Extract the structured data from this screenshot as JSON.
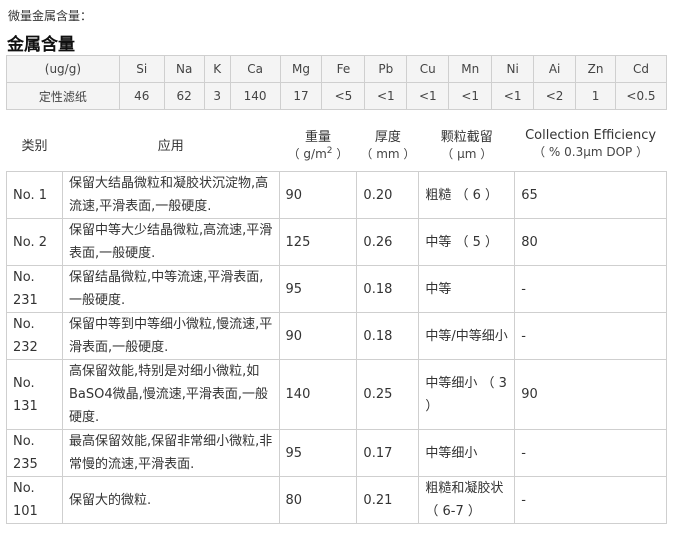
{
  "small_title": "微量金属含量：",
  "big_title": "金属含量",
  "metals": {
    "header": [
      "(ug/g)",
      "Si",
      "Na",
      "K",
      "Ca",
      "Mg",
      "Fe",
      "Pb",
      "Cu",
      "Mn",
      "Ni",
      "Ai",
      "Zn",
      "Cd"
    ],
    "row": [
      "定性滤纸",
      "46",
      "62",
      "3",
      "140",
      "17",
      "<5",
      "<1",
      "<1",
      "<1",
      "<1",
      "<2",
      "1",
      "<0.5"
    ]
  },
  "products": {
    "headers": {
      "category": "类别",
      "application": "应用",
      "weight_line1": "重量",
      "weight_line2_pre": "（ g/m",
      "weight_sup": "2",
      "weight_line2_post": " ）",
      "thickness_line1": "厚度",
      "thickness_line2": "（ mm ）",
      "retention_line1": "颗粒截留",
      "retention_line2": "（ μm ）",
      "efficiency_line1": "Collection Efficiency",
      "efficiency_line2": "（ % 0.3μm DOP ）"
    },
    "rows": [
      {
        "name": "No. 1",
        "application": "保留大结晶微粒和凝胶状沉淀物,高流速,平滑表面,一般硬度.",
        "weight": "90",
        "thickness": "0.20",
        "retention": "粗糙 （ 6 ）",
        "efficiency": "65"
      },
      {
        "name": "No. 2",
        "application": "保留中等大少结晶微粒,高流速,平滑表面,一般硬度.",
        "weight": "125",
        "thickness": "0.26",
        "retention": "中等 （ 5 ）",
        "efficiency": "80"
      },
      {
        "name": "No. 231",
        "application": "保留结晶微粒,中等流速,平滑表面,一般硬度.",
        "weight": "95",
        "thickness": "0.18",
        "retention": "中等",
        "efficiency": "-"
      },
      {
        "name": "No. 232",
        "application": "保留中等到中等细小微粒,慢流速,平滑表面,一般硬度.",
        "weight": "90",
        "thickness": "0.18",
        "retention": "中等/中等细小",
        "efficiency": "-"
      },
      {
        "name": "No. 131",
        "application": "高保留效能,特别是对细小微粒,如BaSO4微晶,慢流速,平滑表面,一般硬度.",
        "weight": "140",
        "thickness": "0.25",
        "retention": "中等细小 （ 3 ）",
        "efficiency": "90"
      },
      {
        "name": "No. 235",
        "application": "最高保留效能,保留非常细小微粒,非常慢的流速,平滑表面.",
        "weight": "95",
        "thickness": "0.17",
        "retention": "中等细小",
        "efficiency": "-"
      },
      {
        "name": "No. 101",
        "application": "保留大的微粒.",
        "weight": "80",
        "thickness": "0.21",
        "retention": "粗糙和凝胶状 （ 6-7 ）",
        "efficiency": "-"
      }
    ]
  }
}
